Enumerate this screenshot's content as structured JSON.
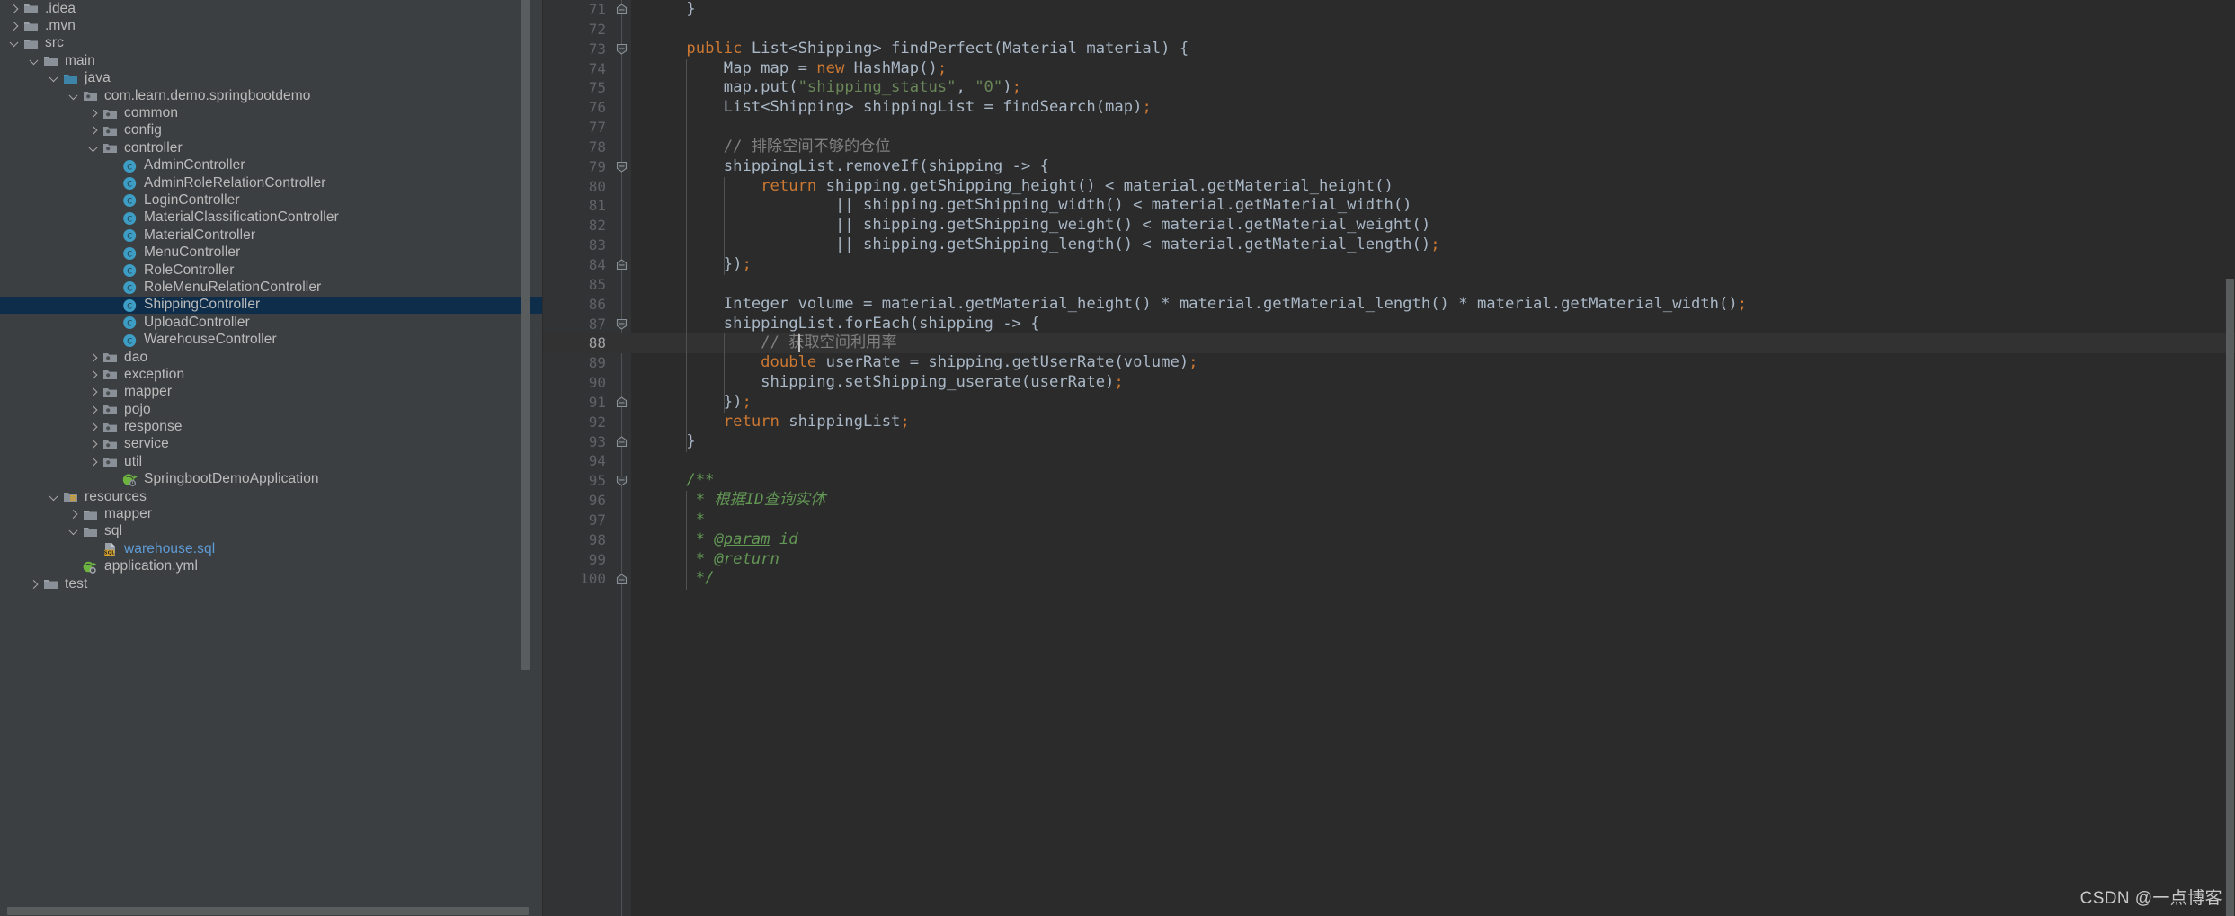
{
  "sidebar": {
    "name": "project-tree",
    "items": [
      {
        "label": ".idea",
        "depth": 0,
        "arrow": "right",
        "icon": "folder",
        "type": "folder"
      },
      {
        "label": ".mvn",
        "depth": 0,
        "arrow": "right",
        "icon": "folder",
        "type": "folder"
      },
      {
        "label": "src",
        "depth": 0,
        "arrow": "down",
        "icon": "folder",
        "type": "folder"
      },
      {
        "label": "main",
        "depth": 1,
        "arrow": "down",
        "icon": "folder",
        "type": "folder"
      },
      {
        "label": "java",
        "depth": 2,
        "arrow": "down",
        "icon": "folder-source",
        "type": "folder"
      },
      {
        "label": "com.learn.demo.springbootdemo",
        "depth": 3,
        "arrow": "down",
        "icon": "package",
        "type": "package"
      },
      {
        "label": "common",
        "depth": 4,
        "arrow": "right",
        "icon": "package",
        "type": "package"
      },
      {
        "label": "config",
        "depth": 4,
        "arrow": "right",
        "icon": "package",
        "type": "package"
      },
      {
        "label": "controller",
        "depth": 4,
        "arrow": "down",
        "icon": "package",
        "type": "package"
      },
      {
        "label": "AdminController",
        "depth": 5,
        "arrow": "none",
        "icon": "class",
        "type": "class"
      },
      {
        "label": "AdminRoleRelationController",
        "depth": 5,
        "arrow": "none",
        "icon": "class",
        "type": "class"
      },
      {
        "label": "LoginController",
        "depth": 5,
        "arrow": "none",
        "icon": "class",
        "type": "class"
      },
      {
        "label": "MaterialClassificationController",
        "depth": 5,
        "arrow": "none",
        "icon": "class",
        "type": "class"
      },
      {
        "label": "MaterialController",
        "depth": 5,
        "arrow": "none",
        "icon": "class",
        "type": "class"
      },
      {
        "label": "MenuController",
        "depth": 5,
        "arrow": "none",
        "icon": "class",
        "type": "class"
      },
      {
        "label": "RoleController",
        "depth": 5,
        "arrow": "none",
        "icon": "class",
        "type": "class"
      },
      {
        "label": "RoleMenuRelationController",
        "depth": 5,
        "arrow": "none",
        "icon": "class",
        "type": "class"
      },
      {
        "label": "ShippingController",
        "depth": 5,
        "arrow": "none",
        "icon": "class",
        "type": "class",
        "selected": true
      },
      {
        "label": "UploadController",
        "depth": 5,
        "arrow": "none",
        "icon": "class",
        "type": "class"
      },
      {
        "label": "WarehouseController",
        "depth": 5,
        "arrow": "none",
        "icon": "class",
        "type": "class"
      },
      {
        "label": "dao",
        "depth": 4,
        "arrow": "right",
        "icon": "package",
        "type": "package"
      },
      {
        "label": "exception",
        "depth": 4,
        "arrow": "right",
        "icon": "package",
        "type": "package"
      },
      {
        "label": "mapper",
        "depth": 4,
        "arrow": "right",
        "icon": "package",
        "type": "package"
      },
      {
        "label": "pojo",
        "depth": 4,
        "arrow": "right",
        "icon": "package",
        "type": "package"
      },
      {
        "label": "response",
        "depth": 4,
        "arrow": "right",
        "icon": "package",
        "type": "package"
      },
      {
        "label": "service",
        "depth": 4,
        "arrow": "right",
        "icon": "package",
        "type": "package"
      },
      {
        "label": "util",
        "depth": 4,
        "arrow": "right",
        "icon": "package",
        "type": "package"
      },
      {
        "label": "SpringbootDemoApplication",
        "depth": 5,
        "arrow": "none",
        "icon": "spring",
        "type": "spring"
      },
      {
        "label": "resources",
        "depth": 2,
        "arrow": "down",
        "icon": "folder-resources",
        "type": "folder"
      },
      {
        "label": "mapper",
        "depth": 3,
        "arrow": "right",
        "icon": "folder",
        "type": "folder"
      },
      {
        "label": "sql",
        "depth": 3,
        "arrow": "down",
        "icon": "folder",
        "type": "folder"
      },
      {
        "label": "warehouse.sql",
        "depth": 4,
        "arrow": "none",
        "icon": "sql-file",
        "type": "sql"
      },
      {
        "label": "application.yml",
        "depth": 3,
        "arrow": "none",
        "icon": "spring-yml",
        "type": "spring"
      },
      {
        "label": "test",
        "depth": 1,
        "arrow": "right",
        "icon": "folder",
        "type": "folder"
      }
    ]
  },
  "editor": {
    "name": "code-editor",
    "file": "ShippingController",
    "current_line": 88,
    "first_line_number": 71,
    "caret": {
      "line": 88,
      "column": 16
    },
    "lines": [
      {
        "n": 71,
        "tokens": [
          {
            "t": "pn",
            "v": "    }"
          }
        ],
        "fold": "end"
      },
      {
        "n": 72,
        "tokens": []
      },
      {
        "n": 73,
        "tokens": [
          {
            "t": "kw",
            "v": "    public "
          },
          {
            "t": "id",
            "v": "List<Shipping> findPerfect(Material material) {"
          }
        ],
        "fold": "start"
      },
      {
        "n": 74,
        "tokens": [
          {
            "t": "id",
            "v": "        Map map = "
          },
          {
            "t": "kw",
            "v": "new "
          },
          {
            "t": "id",
            "v": "HashMap()"
          },
          {
            "t": "semi",
            "v": ";"
          }
        ]
      },
      {
        "n": 75,
        "tokens": [
          {
            "t": "id",
            "v": "        map.put("
          },
          {
            "t": "str",
            "v": "\"shipping_status\""
          },
          {
            "t": "id",
            "v": ", "
          },
          {
            "t": "str",
            "v": "\"0\""
          },
          {
            "t": "id",
            "v": ")"
          },
          {
            "t": "semi",
            "v": ";"
          }
        ]
      },
      {
        "n": 76,
        "tokens": [
          {
            "t": "id",
            "v": "        List<Shipping> shippingList = findSearch(map)"
          },
          {
            "t": "semi",
            "v": ";"
          }
        ]
      },
      {
        "n": 77,
        "tokens": []
      },
      {
        "n": 78,
        "tokens": [
          {
            "t": "cmt",
            "v": "        // 排除空间不够的仓位"
          }
        ]
      },
      {
        "n": 79,
        "tokens": [
          {
            "t": "id",
            "v": "        shippingList.removeIf(shipping -> {"
          }
        ],
        "fold": "start"
      },
      {
        "n": 80,
        "tokens": [
          {
            "t": "kw",
            "v": "            return "
          },
          {
            "t": "id",
            "v": "shipping.getShipping_height() < material.getMaterial_height()"
          }
        ]
      },
      {
        "n": 81,
        "tokens": [
          {
            "t": "id",
            "v": "                    || shipping.getShipping_width() < material.getMaterial_width()"
          }
        ]
      },
      {
        "n": 82,
        "tokens": [
          {
            "t": "id",
            "v": "                    || shipping.getShipping_weight() < material.getMaterial_weight()"
          }
        ]
      },
      {
        "n": 83,
        "tokens": [
          {
            "t": "id",
            "v": "                    || shipping.getShipping_length() < material.getMaterial_length()"
          },
          {
            "t": "semi",
            "v": ";"
          }
        ]
      },
      {
        "n": 84,
        "tokens": [
          {
            "t": "id",
            "v": "        })"
          },
          {
            "t": "semi",
            "v": ";"
          }
        ],
        "fold": "end"
      },
      {
        "n": 85,
        "tokens": []
      },
      {
        "n": 86,
        "tokens": [
          {
            "t": "id",
            "v": "        Integer volume = material.getMaterial_height() * material.getMaterial_length() * material.getMaterial_width()"
          },
          {
            "t": "semi",
            "v": ";"
          }
        ]
      },
      {
        "n": 87,
        "tokens": [
          {
            "t": "id",
            "v": "        shippingList.forEach(shipping -> {"
          }
        ],
        "fold": "start"
      },
      {
        "n": 88,
        "tokens": [
          {
            "t": "cmt",
            "v": "            // 获取空间利用率"
          }
        ],
        "current": true
      },
      {
        "n": 89,
        "tokens": [
          {
            "t": "kw",
            "v": "            double "
          },
          {
            "t": "id",
            "v": "userRate = shipping.getUserRate(volume)"
          },
          {
            "t": "semi",
            "v": ";"
          }
        ]
      },
      {
        "n": 90,
        "tokens": [
          {
            "t": "id",
            "v": "            shipping.setShipping_userate(userRate)"
          },
          {
            "t": "semi",
            "v": ";"
          }
        ]
      },
      {
        "n": 91,
        "tokens": [
          {
            "t": "id",
            "v": "        })"
          },
          {
            "t": "semi",
            "v": ";"
          }
        ],
        "fold": "end"
      },
      {
        "n": 92,
        "tokens": [
          {
            "t": "kw",
            "v": "        return "
          },
          {
            "t": "id",
            "v": "shippingList"
          },
          {
            "t": "semi",
            "v": ";"
          }
        ]
      },
      {
        "n": 93,
        "tokens": [
          {
            "t": "pn",
            "v": "    }"
          }
        ],
        "fold": "end"
      },
      {
        "n": 94,
        "tokens": []
      },
      {
        "n": 95,
        "tokens": [
          {
            "t": "doc",
            "v": "    /**"
          }
        ],
        "fold": "start"
      },
      {
        "n": 96,
        "tokens": [
          {
            "t": "doc",
            "v": "     * 根据ID查询实体"
          }
        ]
      },
      {
        "n": 97,
        "tokens": [
          {
            "t": "doc",
            "v": "     *"
          }
        ]
      },
      {
        "n": 98,
        "tokens": [
          {
            "t": "doc",
            "v": "     * "
          },
          {
            "t": "doctag",
            "v": "@param"
          },
          {
            "t": "doc",
            "v": " id"
          }
        ]
      },
      {
        "n": 99,
        "tokens": [
          {
            "t": "doc",
            "v": "     * "
          },
          {
            "t": "doctag",
            "v": "@return"
          }
        ]
      },
      {
        "n": 100,
        "tokens": [
          {
            "t": "doc",
            "v": "     */"
          }
        ],
        "fold": "end"
      }
    ]
  },
  "watermark": {
    "text": "CSDN @一点博客"
  },
  "colors": {
    "sidebar_bg": "#3c3f41",
    "editor_bg": "#2b2b2b",
    "gutter_bg": "#313335",
    "selection_bg": "#0d2d4b",
    "current_line_bg": "#323232",
    "keyword": "#cc7832",
    "string": "#6a8759",
    "comment": "#808080",
    "javadoc": "#629755",
    "identifier": "#a9b7c6",
    "line_number": "#606366",
    "tree_text": "#bbbbbb",
    "sql_file_text": "#5e9bd6",
    "class_icon": "#3d9dc4"
  }
}
